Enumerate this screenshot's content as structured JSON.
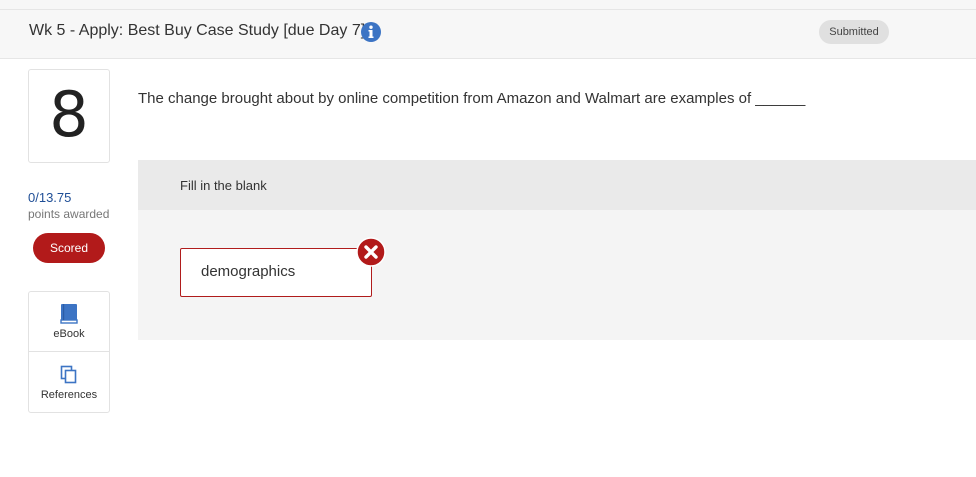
{
  "header": {
    "title": "Wk 5 - Apply: Best Buy Case Study [due Day 7]",
    "status": "Submitted",
    "info_icon": "info-icon"
  },
  "question": {
    "number": "8",
    "points": "0/13.75",
    "points_label": "points awarded",
    "scored_label": "Scored",
    "text": "The change brought about by online competition from Amazon and Walmart are examples of ______"
  },
  "tools": [
    {
      "label": "eBook",
      "icon": "book-icon"
    },
    {
      "label": "References",
      "icon": "copy-icon"
    }
  ],
  "answer": {
    "type_label": "Fill in the blank",
    "value": "demographics",
    "status_icon": "incorrect-icon"
  },
  "colors": {
    "link_blue": "#1f4e96",
    "error_red": "#b21a1a",
    "icon_blue": "#3c74c4"
  }
}
